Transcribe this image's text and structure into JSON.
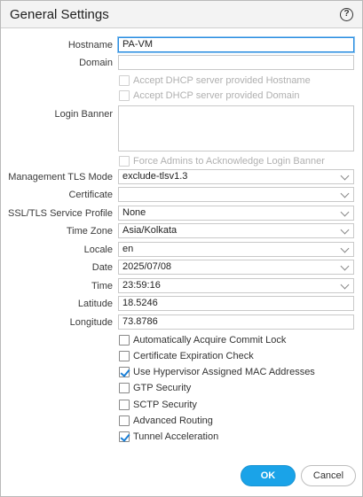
{
  "dialog": {
    "title": "General Settings",
    "help_icon": "question-circle-icon"
  },
  "fields": {
    "hostname": {
      "label": "Hostname",
      "value": "PA-VM"
    },
    "domain": {
      "label": "Domain",
      "value": ""
    },
    "login_banner": {
      "label": "Login Banner",
      "value": ""
    },
    "mgmt_tls_mode": {
      "label": "Management TLS Mode",
      "value": "exclude-tlsv1.3"
    },
    "certificate": {
      "label": "Certificate",
      "value": ""
    },
    "ssl_tls_profile": {
      "label": "SSL/TLS Service Profile",
      "value": "None"
    },
    "time_zone": {
      "label": "Time Zone",
      "value": "Asia/Kolkata"
    },
    "locale": {
      "label": "Locale",
      "value": "en"
    },
    "date": {
      "label": "Date",
      "value": "2025/07/08"
    },
    "time": {
      "label": "Time",
      "value": "23:59:16"
    },
    "latitude": {
      "label": "Latitude",
      "value": "18.5246"
    },
    "longitude": {
      "label": "Longitude",
      "value": "73.8786"
    }
  },
  "disabled_checkboxes": {
    "dhcp_hostname": {
      "label": "Accept DHCP server provided Hostname",
      "checked": false
    },
    "dhcp_domain": {
      "label": "Accept DHCP server provided Domain",
      "checked": false
    },
    "force_banner": {
      "label": "Force Admins to Acknowledge Login Banner",
      "checked": false
    }
  },
  "options": [
    {
      "label": "Automatically Acquire Commit Lock",
      "checked": false
    },
    {
      "label": "Certificate Expiration Check",
      "checked": false
    },
    {
      "label": "Use Hypervisor Assigned MAC Addresses",
      "checked": true
    },
    {
      "label": "GTP Security",
      "checked": false
    },
    {
      "label": "SCTP Security",
      "checked": false
    },
    {
      "label": "Advanced Routing",
      "checked": false
    },
    {
      "label": "Tunnel Acceleration",
      "checked": true
    }
  ],
  "buttons": {
    "ok": "OK",
    "cancel": "Cancel"
  },
  "colors": {
    "accent": "#1aa3e8",
    "check": "#1a7fd6",
    "focus": "#2a8de0"
  }
}
